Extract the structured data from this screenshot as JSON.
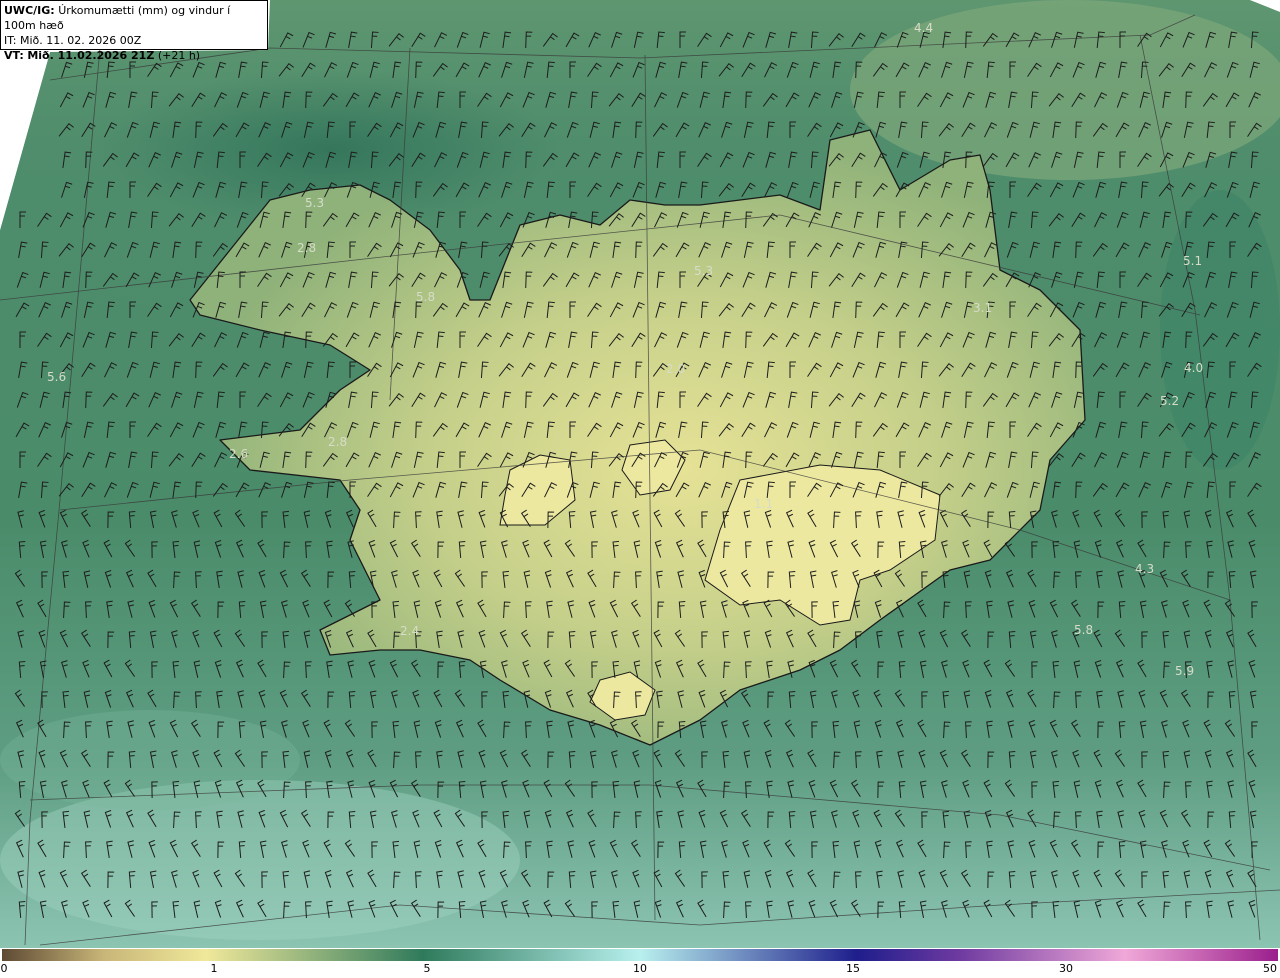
{
  "header": {
    "model": "UWC/IG:",
    "title": "Úrkomumætti (mm) og vindur í 100m hæð",
    "it_line": "IT: Mið. 11. 02. 2026 00Z",
    "vt_prefix": "VT:",
    "vt_bold": "Mið. 11.02.2026 21Z",
    "vt_suffix": "(+21 h)"
  },
  "point_values": [
    {
      "name": "pv-nw-1",
      "text": "5.3"
    },
    {
      "name": "pv-nw-2",
      "text": "2.8"
    },
    {
      "name": "pv-nw-3",
      "text": "5.8"
    },
    {
      "name": "pv-w",
      "text": "5.6"
    },
    {
      "name": "pv-west-2",
      "text": "2.6"
    },
    {
      "name": "pv-west-3",
      "text": "2.8"
    },
    {
      "name": "pv-n",
      "text": "5.3"
    },
    {
      "name": "pv-n-2",
      "text": "2.0"
    },
    {
      "name": "pv-ne-1",
      "text": "4.4"
    },
    {
      "name": "pv-e-1",
      "text": "5.1"
    },
    {
      "name": "pv-e-2",
      "text": "4.0"
    },
    {
      "name": "pv-e-3",
      "text": "5.2"
    },
    {
      "name": "pv-e-4",
      "text": "3.1"
    },
    {
      "name": "pv-c",
      "text": "1.1"
    },
    {
      "name": "pv-se-1",
      "text": "4.3"
    },
    {
      "name": "pv-se-2",
      "text": "5.8"
    },
    {
      "name": "pv-se-3",
      "text": "5.9"
    },
    {
      "name": "pv-sw",
      "text": "2.4"
    }
  ],
  "colorbar": {
    "ticks": [
      "0",
      "1",
      "5",
      "10",
      "15",
      "30",
      "50"
    ],
    "colors": [
      "#5e4a34",
      "#c8b678",
      "#f0e89a",
      "#2f7a5c",
      "#b8f0ee",
      "#1e1e8c",
      "#6e3aa0",
      "#f0a8d8",
      "#9a1e8c"
    ]
  }
}
